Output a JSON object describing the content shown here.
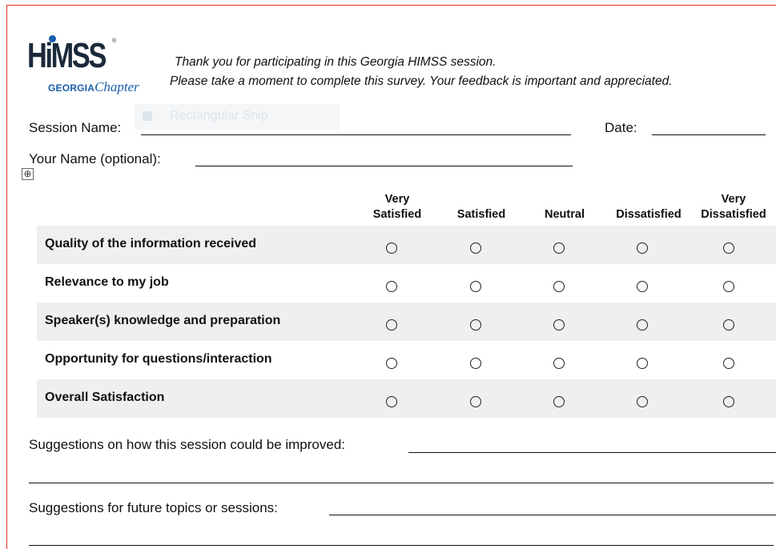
{
  "logo": {
    "wordmark": "HiMSS",
    "sub_bold": "GEORGIA",
    "sub_italic": "Chapter",
    "trademark": "®"
  },
  "intro": {
    "line1": "Thank you for participating in this Georgia HIMSS session.",
    "line2": "Please take a moment to complete this survey.  Your feedback is important and appreciated."
  },
  "snip_tooltip": {
    "label": "Rectangular Snip",
    "icon": "snip-icon"
  },
  "fields": {
    "session_name": "Session Name:",
    "date": "Date:",
    "your_name": "Your Name (optional):"
  },
  "table_move_handle": "⊕",
  "rating_headers": [
    {
      "line1": "Very",
      "line2": "Satisfied"
    },
    {
      "line1": "",
      "line2": "Satisfied"
    },
    {
      "line1": "",
      "line2": "Neutral"
    },
    {
      "line1": "",
      "line2": "Dissatisfied"
    },
    {
      "line1": "Very",
      "line2": "Dissatisfied"
    }
  ],
  "questions": [
    "Quality of the information received",
    "Relevance to my job",
    "Speaker(s) knowledge and preparation",
    "Opportunity for questions/interaction",
    "Overall Satisfaction"
  ],
  "suggestions": {
    "improve": "Suggestions on how this session could be improved:",
    "future": "Suggestions for future topics or sessions:"
  },
  "colors": {
    "border": "#e0322e",
    "logo_blue": "#1a5eab",
    "row_shade": "#efefef"
  }
}
